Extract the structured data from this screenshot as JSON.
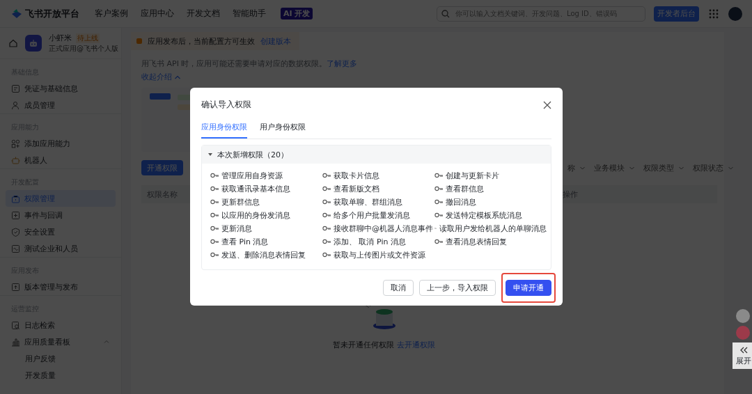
{
  "header": {
    "logo": "飞书开放平台",
    "nav": [
      "客户案例",
      "应用中心",
      "开发文档",
      "智能助手"
    ],
    "ai_badge": "AI 开发",
    "search": {
      "placeholder": "你可以输入文档关键词、开发问题、Log ID、错误码"
    },
    "console_button": "开发者后台"
  },
  "app": {
    "name": "小虾米",
    "status": "待上线",
    "subtitle": "正式应用@飞书个人版"
  },
  "sidebar": {
    "groups": [
      {
        "title": "基础信息",
        "items": [
          {
            "label": "凭证与基础信息",
            "selected": false
          },
          {
            "label": "成员管理",
            "selected": false
          }
        ]
      },
      {
        "title": "应用能力",
        "items": [
          {
            "label": "添加应用能力",
            "selected": false
          },
          {
            "label": "机器人",
            "selected": false
          }
        ]
      },
      {
        "title": "开发配置",
        "items": [
          {
            "label": "权限管理",
            "selected": true
          },
          {
            "label": "事件与回调",
            "selected": false
          },
          {
            "label": "安全设置",
            "selected": false
          },
          {
            "label": "测试企业和人员",
            "selected": false
          }
        ]
      },
      {
        "title": "应用发布",
        "items": [
          {
            "label": "版本管理与发布",
            "selected": false
          }
        ]
      },
      {
        "title": "运营监控",
        "items": [
          {
            "label": "日志检索",
            "selected": false
          },
          {
            "label": "应用质量看板",
            "selected": false,
            "expanded": true,
            "children": [
              {
                "label": "用户反馈",
                "selected": false
              },
              {
                "label": "开发质量",
                "selected": false
              }
            ]
          }
        ]
      }
    ]
  },
  "notice": {
    "text": "应用发布后，当前配置方可生效",
    "link": "创建版本"
  },
  "intro": {
    "text": "用飞书 API 时，应用可能还需要申请对应的数据权限。",
    "link": "了解更多",
    "collapse": "收起介绍"
  },
  "actions": {
    "primary": "开通权限"
  },
  "filters": [
    "称",
    "业务模块",
    "权限类型",
    "权限状态"
  ],
  "table": {
    "columns": [
      "权限名称",
      "操作"
    ]
  },
  "empty": {
    "text": "暂未开通任何权限",
    "link": "去开通权限"
  },
  "side_float": {
    "expand": "展开"
  },
  "dialog": {
    "title": "确认导入权限",
    "tabs": [
      {
        "label": "应用身份权限",
        "selected": true
      },
      {
        "label": "用户身份权限",
        "selected": false
      }
    ],
    "section": {
      "title": "本次新增权限（20）",
      "expanded": true,
      "items": [
        "管理应用自身资源",
        "获取卡片信息",
        "创建与更新卡片",
        "获取通讯录基本信息",
        "查看新版文档",
        "查看群信息",
        "更新群信息",
        "获取单聊、群组消息",
        "撤回消息",
        "以应用的身份发消息",
        "给多个用户批量发消息",
        "发送特定模板系统消息",
        "更新消息",
        "接收群聊中@机器人消息事件",
        "读取用户发给机器人的单聊消息",
        "查看 Pin 消息",
        "添加、 取消 Pin 消息",
        "查看消息表情回复",
        "发送、删除消息表情回复",
        "获取与上传图片或文件资源"
      ]
    },
    "buttons": [
      {
        "label": "取消",
        "kind": "default",
        "highlighted": false
      },
      {
        "label": "上一步，导入权限",
        "kind": "default",
        "highlighted": false
      },
      {
        "label": "申请开通",
        "kind": "primary",
        "highlighted": true
      }
    ]
  }
}
